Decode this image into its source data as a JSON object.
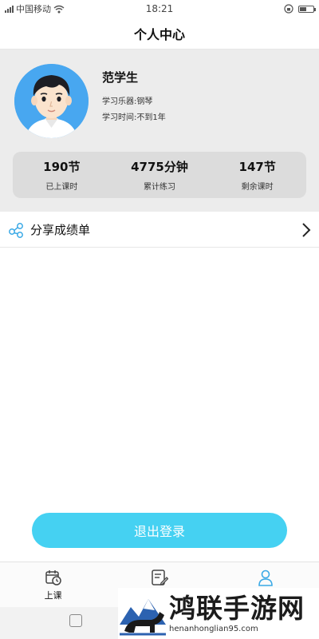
{
  "status_bar": {
    "carrier": "中国移动",
    "time": "18:21"
  },
  "nav": {
    "title": "个人中心"
  },
  "profile": {
    "name": "范学生",
    "instrument": "学习乐器:钢琴",
    "duration": "学习时间:不到1年",
    "avatar_icon": "student-avatar",
    "stats": [
      {
        "value": "190节",
        "label": "已上课时"
      },
      {
        "value": "4775分钟",
        "label": "累计练习"
      },
      {
        "value": "147节",
        "label": "剩余课时"
      }
    ]
  },
  "share": {
    "label": "分享成绩单",
    "icon": "share-nodes-icon"
  },
  "logout": {
    "label": "退出登录"
  },
  "tabs": [
    {
      "label": "上课",
      "icon": "calendar-clock-icon",
      "active": false
    },
    {
      "label": "",
      "icon": "notes-pencil-icon",
      "active": false
    },
    {
      "label": "",
      "icon": "person-icon",
      "active": true
    }
  ],
  "watermark": {
    "title": "鸿联手游网",
    "url": "henanhonglian95.com"
  },
  "colors": {
    "accent": "#45d1f2",
    "active_tab": "#3aa9e6",
    "profile_bg": "#ececec",
    "stats_bg": "#dcdcdc"
  }
}
